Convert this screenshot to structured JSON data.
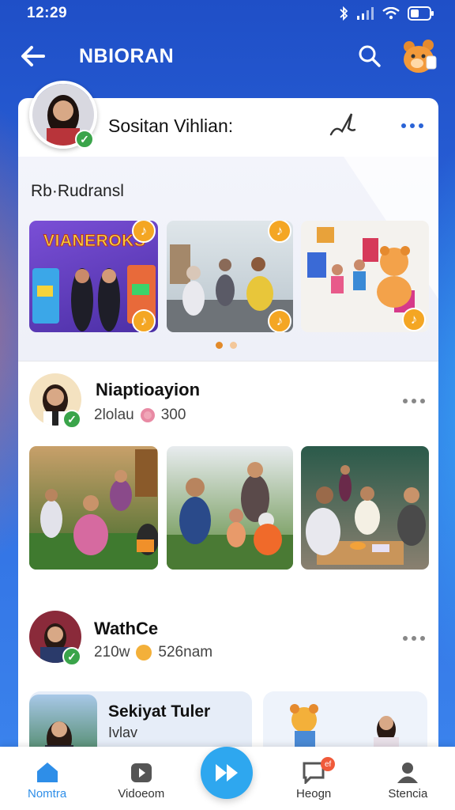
{
  "status_bar": {
    "time": "12:29"
  },
  "header": {
    "title": "NBIORAN"
  },
  "profile": {
    "name": "Sositan Vihlian:"
  },
  "featured": {
    "label": "Rb·Rudransl",
    "thumb1_text": "VIANEROKS"
  },
  "posts": [
    {
      "name": "Niaptioayion",
      "meta_left": "2lolau",
      "meta_right": "300"
    },
    {
      "name": "WathCe",
      "meta_left": "210w",
      "meta_right": "526nam"
    }
  ],
  "peek_card": {
    "title": "Sekiyat Tuler",
    "subtitle": "Ivlav"
  },
  "bottom_nav": {
    "items": [
      {
        "label": "Nomtra"
      },
      {
        "label": "Vidoeom"
      },
      {
        "label": "Heogn",
        "badge": "ef"
      },
      {
        "label": "Stencia"
      }
    ]
  },
  "colors": {
    "accent": "#2ea7ef",
    "brand": "#2a63d6",
    "verified": "#3aa44a",
    "badge": "#f4a623"
  }
}
